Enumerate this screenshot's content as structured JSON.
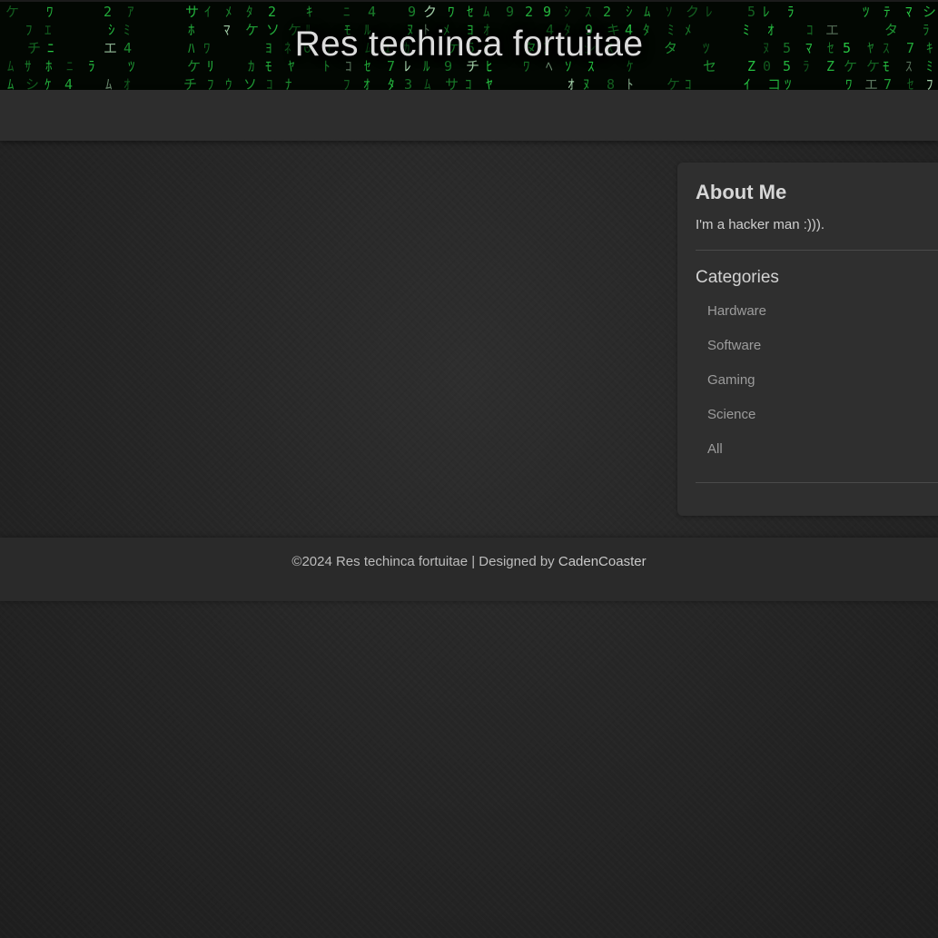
{
  "header": {
    "title": "Res techinca fortuitae"
  },
  "about": {
    "title": "About Me",
    "text": "I'm a hacker man :)))."
  },
  "categories": {
    "title": "Categories",
    "items": [
      "Hardware",
      "Software",
      "Gaming",
      "Science",
      "All"
    ]
  },
  "footer": {
    "copyright": "©2024 Res techinca fortuitae",
    "separator": " | Designed by ",
    "designer": "CadenCoaster"
  },
  "colors": {
    "matrix_green": "#2bd94a",
    "page_background": "#262626",
    "navbar": "#2d2d2d",
    "sidebar": "#2f2f2f"
  }
}
